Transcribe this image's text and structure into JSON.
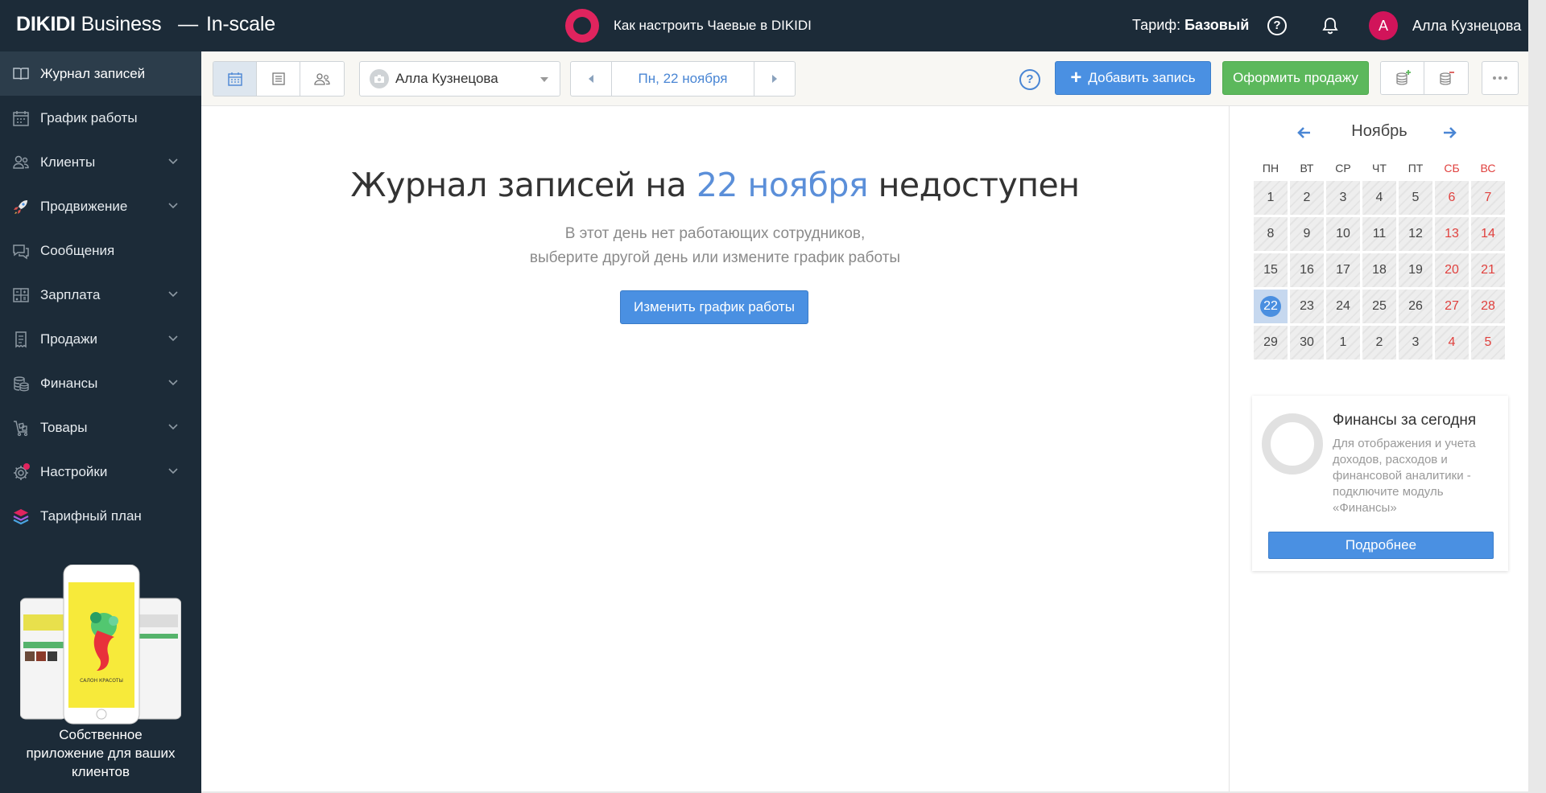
{
  "header": {
    "brand_bold": "DIKIDI",
    "brand_rest": "Business",
    "brand_sep": "—",
    "brand_scale": "In-scale",
    "tip_text": "Как настроить Чаевые в DIKIDI",
    "tariff_label": "Тариф:",
    "tariff_value": "Базовый",
    "help_glyph": "?",
    "avatar_letter": "А",
    "user_name": "Алла Кузнецова"
  },
  "sidebar": {
    "items": [
      {
        "label": "Журнал записей",
        "icon": "journal-icon",
        "active": true
      },
      {
        "label": "График работы",
        "icon": "calendar-icon"
      },
      {
        "label": "Клиенты",
        "icon": "clients-icon"
      },
      {
        "label": "Продвижение",
        "icon": "rocket-icon"
      },
      {
        "label": "Сообщения",
        "icon": "messages-icon"
      },
      {
        "label": "Зарплата",
        "icon": "salary-icon"
      },
      {
        "label": "Продажи",
        "icon": "sales-icon"
      },
      {
        "label": "Финансы",
        "icon": "finance-icon"
      },
      {
        "label": "Товары",
        "icon": "goods-icon"
      },
      {
        "label": "Настройки",
        "icon": "settings-icon"
      },
      {
        "label": "Тарифный план",
        "icon": "layers-icon"
      }
    ],
    "promo_line1": "Собственное",
    "promo_line2": "приложение для ваших",
    "promo_line3": "клиентов",
    "promo_phone_text": "САЛОН КРАСОТЫ"
  },
  "toolbar": {
    "staff_name": "Алла Кузнецова",
    "date_label": "Пн, 22 ноября",
    "help_glyph": "?",
    "add_label": "Добавить запись",
    "add_plus": "+",
    "sale_label": "Оформить продажу"
  },
  "empty": {
    "title_pre": "Журнал записей на ",
    "title_date": "22 ноября",
    "title_post": " недоступен",
    "sub_line1": "В этот день нет работающих сотрудников,",
    "sub_line2": "выберите другой день или измените график работы",
    "button": "Изменить график работы"
  },
  "calendar": {
    "month": "Ноябрь",
    "dows": [
      "ПН",
      "ВТ",
      "СР",
      "ЧТ",
      "ПТ",
      "СБ",
      "ВС"
    ],
    "days": [
      "1",
      "2",
      "3",
      "4",
      "5",
      "6",
      "7",
      "8",
      "9",
      "10",
      "11",
      "12",
      "13",
      "14",
      "15",
      "16",
      "17",
      "18",
      "19",
      "20",
      "21",
      "22",
      "23",
      "24",
      "25",
      "26",
      "27",
      "28",
      "29",
      "30",
      "1",
      "2",
      "3",
      "4",
      "5"
    ],
    "selected_index": 21
  },
  "finance": {
    "title": "Финансы за сегодня",
    "desc": "Для отображения и учета доходов, расходов и финансовой аналитики - подключите модуль «Финансы»",
    "button": "Подробнее"
  },
  "colors": {
    "dark_bg": "#1c2b38",
    "accent_blue": "#4a90e2",
    "accent_green": "#5cb85c",
    "weekend_red": "#e0413e"
  }
}
